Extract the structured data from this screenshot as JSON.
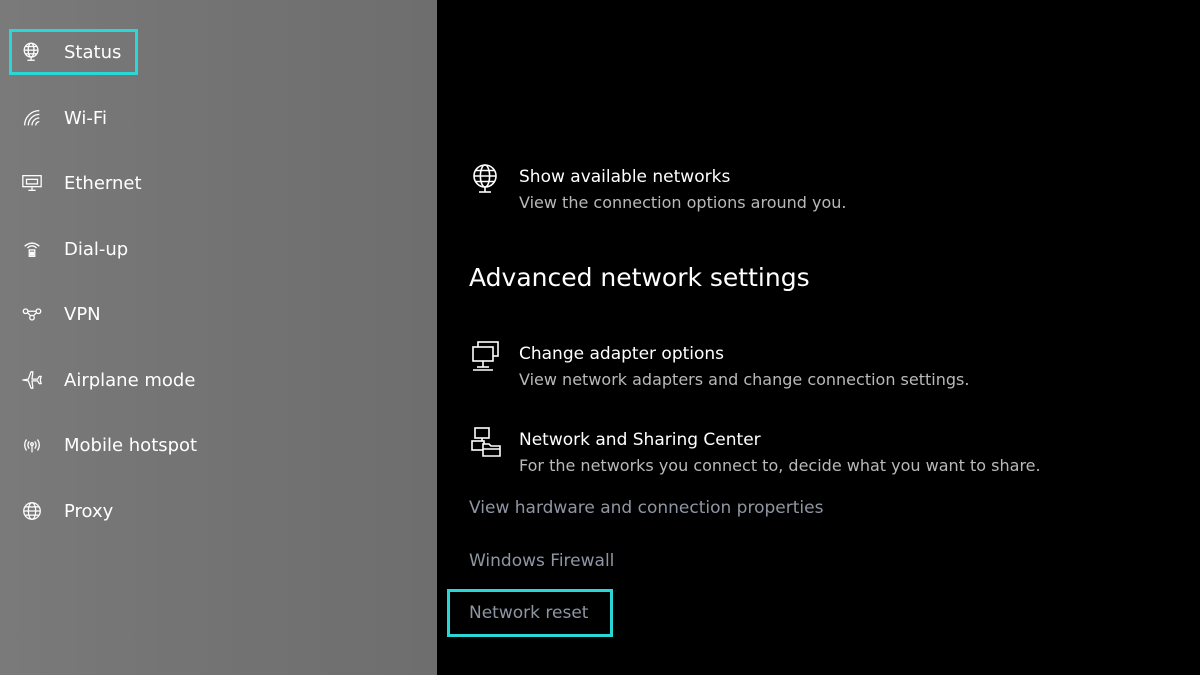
{
  "sidebar": {
    "items": [
      {
        "label": "Status",
        "icon": "globe-monitor-icon"
      },
      {
        "label": "Wi-Fi",
        "icon": "wifi-icon"
      },
      {
        "label": "Ethernet",
        "icon": "ethernet-icon"
      },
      {
        "label": "Dial-up",
        "icon": "dialup-icon"
      },
      {
        "label": "VPN",
        "icon": "vpn-icon"
      },
      {
        "label": "Airplane mode",
        "icon": "airplane-icon"
      },
      {
        "label": "Mobile hotspot",
        "icon": "hotspot-icon"
      },
      {
        "label": "Proxy",
        "icon": "globe-icon"
      }
    ],
    "selected": "Status"
  },
  "main": {
    "show_networks": {
      "title": "Show available networks",
      "desc": "View the connection options around you."
    },
    "advanced_heading": "Advanced network settings",
    "adapter_options": {
      "title": "Change adapter options",
      "desc": "View network adapters and change connection settings."
    },
    "sharing_center": {
      "title": "Network and Sharing Center",
      "desc": "For the networks you connect to, decide what you want to share."
    },
    "links": {
      "hardware_props": "View hardware and connection properties",
      "firewall": "Windows Firewall",
      "network_reset": "Network reset"
    }
  },
  "colors": {
    "highlight": "#2ad7d7",
    "link": "#8f96a3",
    "sidebar_bg": "#767676",
    "main_bg": "#000000"
  }
}
